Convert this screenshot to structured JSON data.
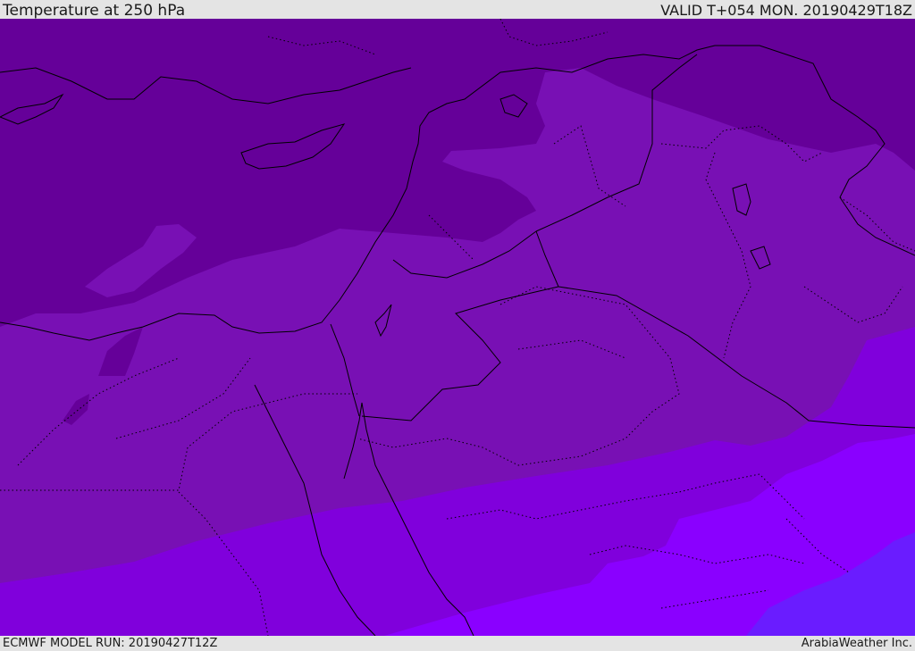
{
  "header": {
    "title": "Temperature at 250 hPa",
    "valid_time": "VALID T+054 MON. 20190429T18Z"
  },
  "footer": {
    "model_run": "ECMWF MODEL RUN: 20190427T12Z",
    "brand": "ArabiaWeather Inc."
  },
  "colors": {
    "band_coldest": "#650099",
    "band_cold": "#7810b4",
    "band_mid": "#8000dc",
    "band_warm": "#8a00ff",
    "band_warmest": "#6a1cff",
    "coastline": "#000000",
    "border": "#000000"
  }
}
